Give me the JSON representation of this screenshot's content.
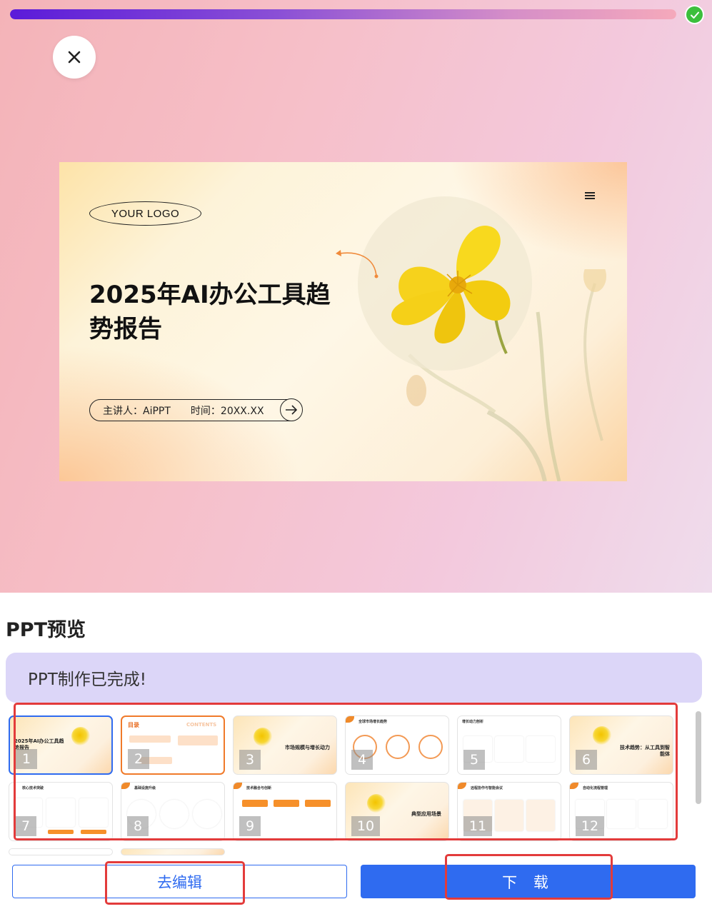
{
  "progress": {
    "value": 1.0,
    "status": "complete"
  },
  "slide": {
    "logo_text": "YOUR LOGO",
    "title_line1": "2025年AI办公工具趋",
    "title_line2": "势报告",
    "presenter": "主讲人：AiPPT",
    "time": "时间：20XX.XX"
  },
  "panel": {
    "title": "PPT预览",
    "status_message": "PPT制作已完成!"
  },
  "thumbnails": [
    {
      "number": "1",
      "text": "2025年AI办公工具趋势报告"
    },
    {
      "number": "2",
      "text": "目录",
      "sub": "CONTENTS"
    },
    {
      "number": "3",
      "text": "市场规模与增长动力"
    },
    {
      "number": "4",
      "text": "全球市场增长趋势"
    },
    {
      "number": "5",
      "text": "增长动力剖析"
    },
    {
      "number": "6",
      "text": "技术趋势：从工具到智能体"
    },
    {
      "number": "7",
      "text": "核心技术突破"
    },
    {
      "number": "8",
      "text": "基础设施升级"
    },
    {
      "number": "9",
      "text": "技术融合与创新"
    },
    {
      "number": "10",
      "text": "典型应用场景"
    },
    {
      "number": "11",
      "text": "远程协作与智能会议"
    },
    {
      "number": "12",
      "text": "自动化流程管理"
    }
  ],
  "buttons": {
    "edit": "去编辑",
    "download": "下 载"
  },
  "colors": {
    "accent": "#2f6bf0",
    "highlight": "#e33b3b",
    "status_bg": "#dcd6f8",
    "success": "#3cbf3c"
  },
  "icons": {
    "close": "close-icon",
    "check": "check-icon",
    "menu": "menu-icon",
    "arrow": "arrow-right-icon"
  }
}
